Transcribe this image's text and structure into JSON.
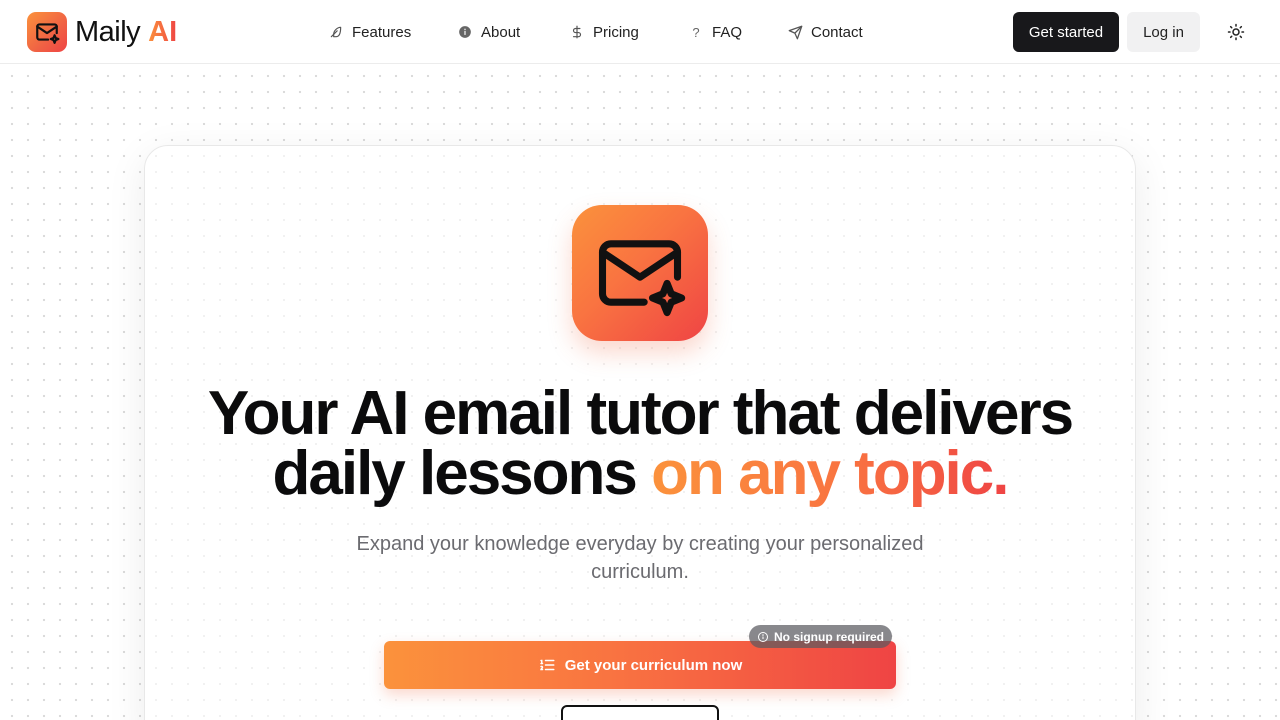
{
  "header": {
    "brand_name": "Maily",
    "brand_ai": "AI",
    "nav": [
      {
        "label": "Features",
        "icon": "feather-icon"
      },
      {
        "label": "About",
        "icon": "info-icon"
      },
      {
        "label": "Pricing",
        "icon": "dollar-icon"
      },
      {
        "label": "FAQ",
        "icon": "question-icon"
      },
      {
        "label": "Contact",
        "icon": "send-icon"
      }
    ],
    "get_started_label": "Get started",
    "login_label": "Log in",
    "theme_toggle_icon": "sun-icon"
  },
  "hero": {
    "icon": "mail-sparkle-icon",
    "headline_line1": "Your AI email tutor that delivers",
    "headline_line2_plain": "daily lessons",
    "headline_line2_accent": "on any topic.",
    "subtitle": "Expand your knowledge everyday by creating your personalized curriculum.",
    "cta_label": "Get your curriculum now",
    "cta_icon": "list-ordered-icon",
    "badge_label": "No signup required",
    "badge_icon": "info-circle-icon"
  },
  "colors": {
    "accent_start": "#fb923c",
    "accent_end": "#ef4444",
    "dark_button": "#18181b"
  }
}
